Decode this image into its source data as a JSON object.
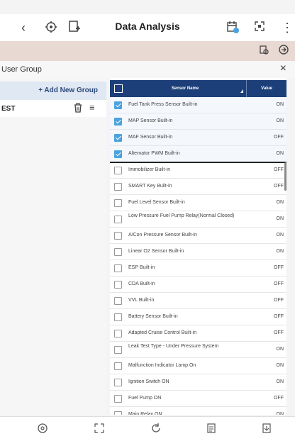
{
  "header": {
    "title": "Data Analysis",
    "back_icon": "chevron-left-icon"
  },
  "user_group": {
    "title": "User Group",
    "close_glyph": "×",
    "add_label": "+ Add New Group",
    "groups": [
      {
        "name": "EST"
      }
    ]
  },
  "table": {
    "col_name": "Sensor Name",
    "col_value": "Value",
    "rows": [
      {
        "name": "Fuel Tank Press Sensor Built-in",
        "value": "ON",
        "checked": true
      },
      {
        "name": "MAP Sensor Built-in",
        "value": "ON",
        "checked": true
      },
      {
        "name": "MAF Sensor Built-in",
        "value": "OFF",
        "checked": true
      },
      {
        "name": "Alternator PWM Built-in",
        "value": "ON",
        "checked": true
      },
      {
        "name": "Immobilizer Built-in",
        "value": "OFF",
        "checked": false
      },
      {
        "name": "SMART Key Built-in",
        "value": "OFF",
        "checked": false
      },
      {
        "name": "Fuel Level Sensor Built-in",
        "value": "ON",
        "checked": false
      },
      {
        "name": "Low Pressure Fuel Pump Relay(Normal Closed)",
        "value": "ON",
        "checked": false
      },
      {
        "name": "A/Con Pressure Sensor Built-in",
        "value": "ON",
        "checked": false
      },
      {
        "name": "Linear O2 Sensor Built-in",
        "value": "ON",
        "checked": false
      },
      {
        "name": "ESP Built-in",
        "value": "OFF",
        "checked": false
      },
      {
        "name": "CDA Built-in",
        "value": "OFF",
        "checked": false
      },
      {
        "name": "VVL Built-in",
        "value": "OFF",
        "checked": false
      },
      {
        "name": "Battery Sensor Built-in",
        "value": "OFF",
        "checked": false
      },
      {
        "name": "Adapted Cruise Control Built-in",
        "value": "OFF",
        "checked": false
      },
      {
        "name": "Leak Test Type - Under Pressure System",
        "value": "ON",
        "checked": false
      },
      {
        "name": "Malfunction Indicator Lamp On",
        "value": "ON",
        "checked": false
      },
      {
        "name": "Ignition Switch ON",
        "value": "ON",
        "checked": false
      },
      {
        "name": "Fuel Pump ON",
        "value": "OFF",
        "checked": false
      },
      {
        "name": "Main Relay ON",
        "value": "ON",
        "checked": false
      }
    ]
  },
  "colors": {
    "header_bg": "#1c3f79",
    "checkbox_on": "#4aa3df",
    "banner_bg": "#e9d9d3"
  }
}
